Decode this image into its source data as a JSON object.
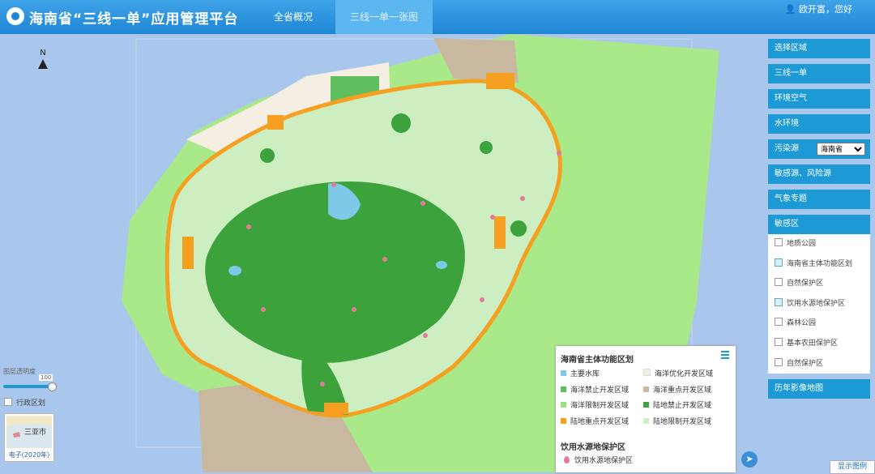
{
  "app": {
    "title": "海南省“三线一单”应用管理平台"
  },
  "nav": {
    "tabs": [
      {
        "label": "全省概况"
      },
      {
        "label": "三线一单一张图"
      }
    ]
  },
  "user": {
    "greeting": "欧开富，您好"
  },
  "map": {
    "north": "N"
  },
  "sidebar": {
    "buttons": [
      "选择区域",
      "三线一单",
      "环境空气",
      "水环境"
    ],
    "pollution": {
      "label": "污染源",
      "selected": "海南省"
    },
    "buttons2": [
      "敏感源、风险源",
      "气象专题"
    ],
    "sensitive": {
      "label": "敏感区",
      "items": [
        {
          "label": "地质公园",
          "checked": false
        },
        {
          "label": "海南省主体功能区划",
          "checked": true
        },
        {
          "label": "自然保护区",
          "checked": false
        },
        {
          "label": "饮用水源地保护区",
          "checked": true
        },
        {
          "label": "森林公园",
          "checked": false
        },
        {
          "label": "基本农田保护区",
          "checked": false
        },
        {
          "label": "自然保护区",
          "checked": false
        }
      ]
    },
    "history": "历年影像地图"
  },
  "legend": {
    "title": "海南省主体功能区划",
    "rows": [
      [
        {
          "label": "主要水库",
          "color": "#7ec8e8"
        },
        {
          "label": "海洋优化开发区域",
          "color": "#f4efe2"
        }
      ],
      [
        {
          "label": "海洋禁止开发区域",
          "color": "#5fbf5f"
        },
        {
          "label": "海洋重点开发区域",
          "color": "#c9b8a0"
        }
      ],
      [
        {
          "label": "海洋限制开发区域",
          "color": "#9be07a"
        },
        {
          "label": "陆地禁止开发区域",
          "color": "#3ca23c"
        }
      ],
      [
        {
          "label": "陆地重点开发区域",
          "color": "#f5a020"
        },
        {
          "label": "陆地限制开发区域",
          "color": "#cdeec0"
        }
      ]
    ],
    "section2": "饮用水源地保护区",
    "section2_item": "饮用水源地保护区",
    "toggle": "显示图例"
  },
  "tools": {
    "opacity_label": "图层透明度",
    "opacity_value": "100",
    "boundary_label": "行政区划",
    "basemap": {
      "city": "三亚市",
      "caption": "电子(2020年)"
    }
  }
}
